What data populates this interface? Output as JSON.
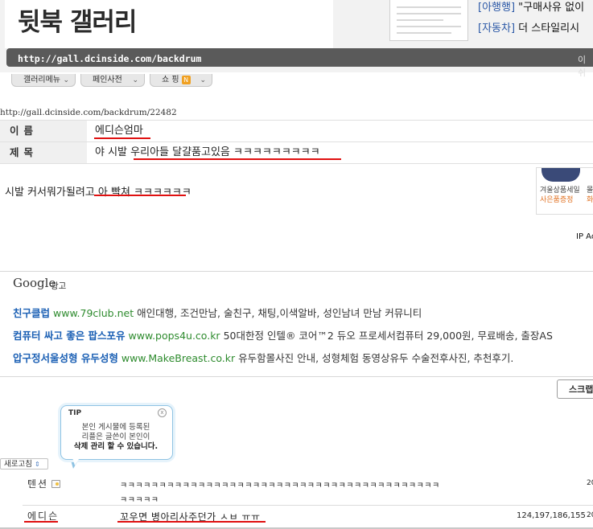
{
  "header": {
    "gallery_title": "뒷북 갤러리",
    "news": [
      {
        "tag": "[아행행]",
        "text": "\"구매사유 없이"
      },
      {
        "tag": "[자동차]",
        "text": "더 스타일리시"
      }
    ],
    "gallery_url": "http://gall.dcinside.com/backdrum",
    "url_right": "이쉬"
  },
  "menu": {
    "tabs": [
      {
        "label": "갤러리메뉴"
      },
      {
        "label": "페인사전"
      },
      {
        "label": "쇼 핑",
        "badge": "N"
      }
    ]
  },
  "post": {
    "url": "http://gall.dcinside.com/backdrum/22482",
    "name_label": "이름",
    "name": "에디슨엄마",
    "subject_label": "제목",
    "subject_prefix": "야 시발 ",
    "subject_highlight": "우리아들 달걀품고있음 ㅋㅋㅋㅋㅋㅋㅋㅋㅋ",
    "body_prefix": "시발 커서뭐가될려고 ",
    "body_highlight": "아 빡쳐 ㅋㅋㅋㅋㅋㅋ",
    "ip_label": "IP Ac"
  },
  "side_ad": {
    "line1": "겨울상품세일",
    "line2": "사은품증정",
    "line3": "몰",
    "line4": "화"
  },
  "google_ads": {
    "logo": "Google",
    "suffix": "광고",
    "items": [
      {
        "title": "친구클럽",
        "site": "www.79club.net",
        "desc": "애인대행, 조건만남, 술친구, 채팅,이색알바, 성인남녀 만남 커뮤니티"
      },
      {
        "title": "컴퓨터 싸고 좋은 팝스포유",
        "site": "www.pops4u.co.kr",
        "desc": "50대한정 인텔® 코어™2 듀오 프로세서컴퓨터 29,000원, 무료배송, 출장AS"
      },
      {
        "title": "압구정서울성형 유두성형",
        "site": "www.MakeBreast.co.kr",
        "desc": "유두함몰사진 안내, 성형체험 동영상유두 수술전후사진, 추천후기."
      }
    ]
  },
  "scrap_button": "스크랩",
  "tip": {
    "title": "TIP",
    "close": "x",
    "line1": "본인 게시물에 등록된",
    "line2": "리플은 글쓴이 본인이",
    "line3": "삭제 관리 할 수 있습니다."
  },
  "refresh_button": "새로고침",
  "comments": [
    {
      "name": "텐션",
      "text1": "ㅋㅋㅋㅋㅋㅋㅋㅋㅋㅋㅋㅋㅋㅋㅋㅋㅋㅋㅋㅋㅋㅋㅋㅋㅋㅋㅋㅋㅋㅋㅋㅋㅋㅋㅋㅋㅋㅋㅋㅋㅋ",
      "text2": "ㅋㅋㅋㅋㅋ",
      "ip": "",
      "date": "20"
    },
    {
      "name": "에디슨",
      "text1": "꼬우면 병아리사주던가 ㅅㅂ ㅠㅠ",
      "text2": "",
      "ip": "124,197,186,155",
      "date": "20"
    }
  ]
}
